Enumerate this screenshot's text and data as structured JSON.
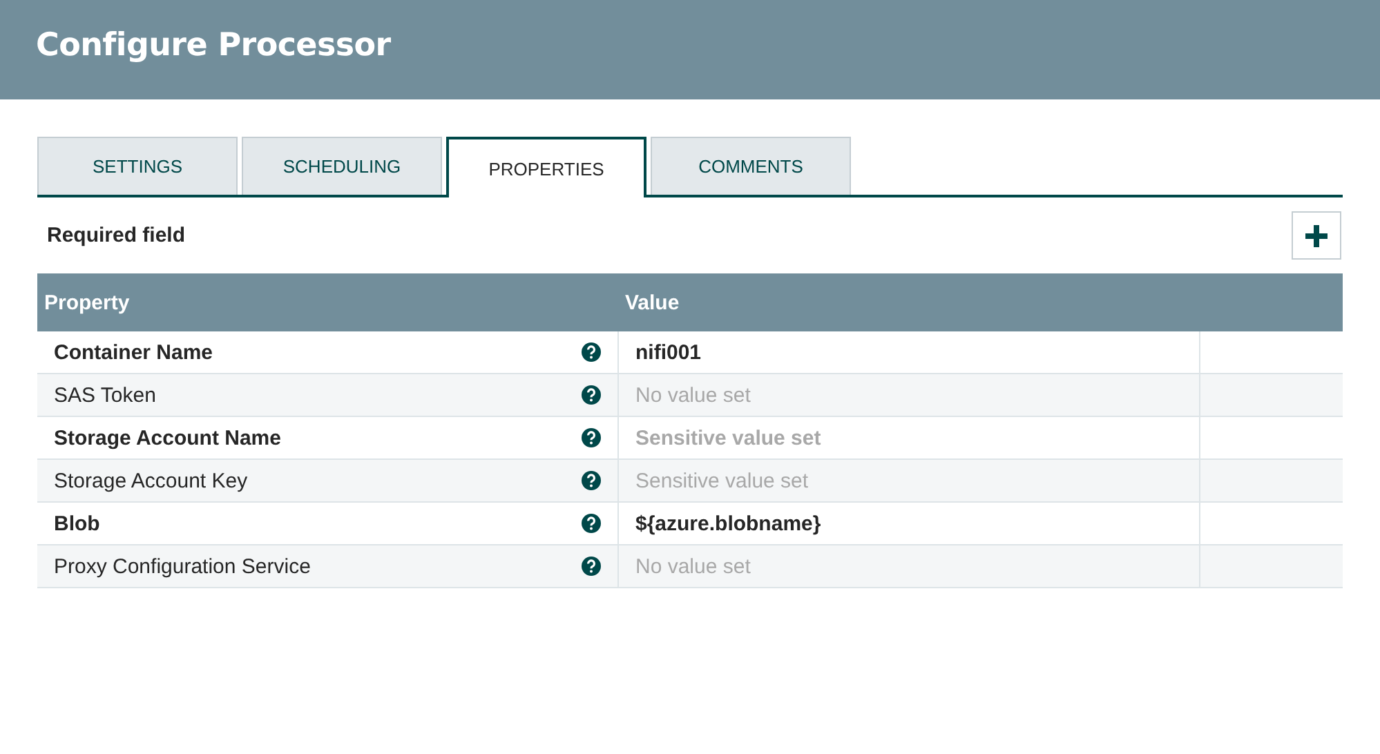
{
  "window": {
    "title": "Configure Processor"
  },
  "tabs": [
    {
      "label": "SETTINGS",
      "selected": false
    },
    {
      "label": "SCHEDULING",
      "selected": false
    },
    {
      "label": "PROPERTIES",
      "selected": true
    },
    {
      "label": "COMMENTS",
      "selected": false
    }
  ],
  "required_note": "Required field",
  "table": {
    "columns": [
      "Property",
      "Value"
    ],
    "rows": [
      {
        "property": "Container Name",
        "required": true,
        "value": "nifi001",
        "greyed": false
      },
      {
        "property": "SAS Token",
        "required": false,
        "value": "No value set",
        "greyed": true
      },
      {
        "property": "Storage Account Name",
        "required": true,
        "value": "Sensitive value set",
        "greyed": true
      },
      {
        "property": "Storage Account Key",
        "required": false,
        "value": "Sensitive value set",
        "greyed": true
      },
      {
        "property": "Blob",
        "required": true,
        "value": "${azure.blobname}",
        "greyed": false
      },
      {
        "property": "Proxy Configuration Service",
        "required": false,
        "value": "No value set",
        "greyed": true
      }
    ]
  }
}
